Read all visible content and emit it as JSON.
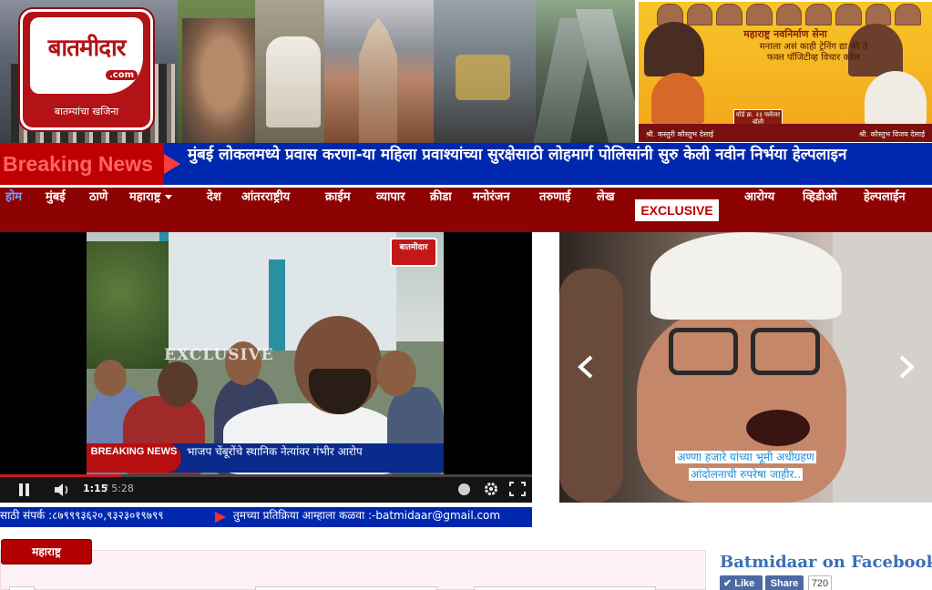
{
  "header": {
    "logo": {
      "name": "बातमीदार",
      "domain": ".com",
      "tagline": "बातम्यांचा खजिना"
    },
    "ad": {
      "title": "महाराष्ट्र नवनिर्माण सेना",
      "text": "मनाला असं काही ट्रेनिंग द्या की ते फक्त पॉजिटीव्ह विचार करेल",
      "badge": "वॉर्ड क्र. २३ फ्लॅावर व्हॅली",
      "left_name": "श्री. कस्तुरी कौस्तुभ देसाई",
      "right_name": "श्री. कौस्तुभ विजय देसाई"
    }
  },
  "breaking": {
    "label": "Breaking News",
    "text": "मुंबई लोकलमध्ये प्रवास करणा-या महिला प्रवाश्यांच्या सुरक्षेसाठी लोहमार्ग पोलिसांनी सुरु केली नवीन निर्भया हेल्पलाइन"
  },
  "nav": {
    "items": [
      "होम",
      "मुंबई",
      "ठाणे",
      "महाराष्ट्र",
      "देश",
      "आंतरराष्ट्रीय",
      "क्राईम",
      "व्यापार",
      "क्रीडा",
      "मनोरंजन",
      "तरुणाई",
      "लेख",
      "EXCLUSIVE",
      "आरोग्य",
      "व्हिडीओ",
      "हेल्पलाईन"
    ],
    "active": "होम"
  },
  "video": {
    "channel_logo": "बातमीदार",
    "watermark": "EXCLUSIVE",
    "breaking_badge": "BREAKING NEWS",
    "ticker": "भाजप चेंबूरोंचे स्थानिक नेत्यांवर गंभीर आरोप",
    "current_time": "1:15",
    "total_time": "/ 5:28",
    "progress": 0.23
  },
  "slider": {
    "caption_line1": "अण्णा हजारे यांच्या भूमी अधीग्रहण",
    "caption_line2": "आंदोलनाची रुपरेषा जाहीर.."
  },
  "contact": {
    "left": "साठी संपर्क :८७९९९३६२०,९३२३०१९७९९",
    "right": "तुमच्या प्रतिक्रिया आम्हाला कळवा :-batmidaar@gmail.com"
  },
  "section": {
    "tab": "महाराष्ट्र"
  },
  "facebook": {
    "title": "Batmidaar on Facebook",
    "like": "Like",
    "share": "Share",
    "count": "720"
  },
  "colors": {
    "nav_bg": "#8d0303",
    "breaking_bg": "#0028ae",
    "breaking_label_bg": "#bf0000",
    "accent_red": "#b30000",
    "fb_blue": "#4e69a2"
  }
}
